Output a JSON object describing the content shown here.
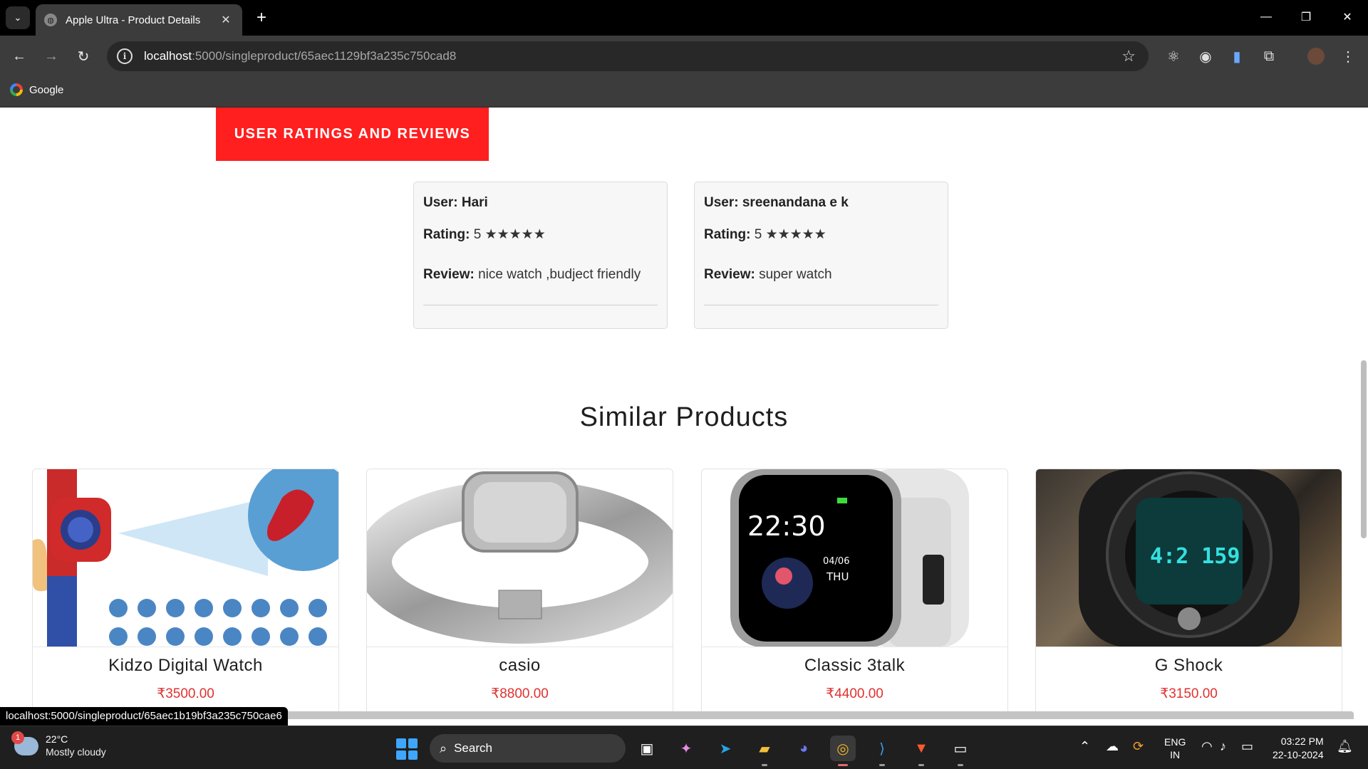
{
  "browser": {
    "tab_title": "Apple Ultra - Product Details",
    "url_host": "localhost",
    "url_path": ":5000/singleproduct/65aec1129bf3a235c750cad8",
    "bookmarks": [
      {
        "label": "Google"
      }
    ]
  },
  "page": {
    "reviews_heading": "USER RATINGS AND REVIEWS",
    "reviews": [
      {
        "user_label": "User:",
        "user": "Hari",
        "rating_label": "Rating:",
        "rating": "5",
        "stars": "★★★★★",
        "review_label": "Review:",
        "review": "nice watch ,budject friendly"
      },
      {
        "user_label": "User:",
        "user": "sreenandana e k",
        "rating_label": "Rating:",
        "rating": "5",
        "stars": "★★★★★",
        "review_label": "Review:",
        "review": "super watch"
      }
    ],
    "similar_heading": "Similar Products",
    "products": [
      {
        "name": "Kidzo Digital Watch",
        "price": "₹3500.00"
      },
      {
        "name": "casio",
        "price": "₹8800.00"
      },
      {
        "name": "Classic 3talk",
        "price": "₹4400.00"
      },
      {
        "name": "G Shock",
        "price": "₹3150.00"
      }
    ],
    "smartwatch_time": "22:30",
    "smartwatch_date": "04/06",
    "smartwatch_day": "THU",
    "gshock_time": "4:2 159"
  },
  "status_url": "localhost:5000/singleproduct/65aec1b19bf3a235c750cae6",
  "taskbar": {
    "weather_temp": "22°C",
    "weather_desc": "Mostly cloudy",
    "weather_badge": "1",
    "search_label": "Search",
    "lang_top": "ENG",
    "lang_bottom": "IN",
    "time": "03:22 PM",
    "date": "22-10-2024"
  },
  "colors": {
    "accent_red": "#ff1f1f",
    "price_red": "#e0312f"
  }
}
